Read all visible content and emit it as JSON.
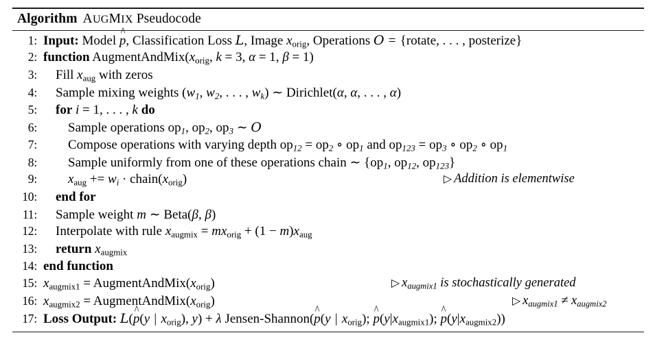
{
  "algorithm": {
    "header_keyword": "Algorithm",
    "title": "AUGMIX Pseudocode",
    "title_smallcaps_part": "AugMix",
    "title_rest": "Pseudocode",
    "lines": [
      {
        "number": "1:",
        "indent": 0,
        "keyword": "Input:",
        "text": "Model p̂, Classification Loss L, Image x_orig, Operations O = {rotate, . . . , posterize}",
        "comment": ""
      },
      {
        "number": "2:",
        "indent": 0,
        "keyword": "function",
        "text": "AugmentAndMix(x_orig, k = 3, α = 1, β = 1)",
        "comment": ""
      },
      {
        "number": "3:",
        "indent": 1,
        "keyword": "",
        "text": "Fill x_aug with zeros",
        "comment": ""
      },
      {
        "number": "4:",
        "indent": 1,
        "keyword": "",
        "text": "Sample mixing weights (w_1, w_2, . . . , w_k) ~ Dirichlet(α, α, . . . , α)",
        "comment": ""
      },
      {
        "number": "5:",
        "indent": 1,
        "keyword": "for ... do",
        "text": "for i = 1, . . . , k do",
        "comment": ""
      },
      {
        "number": "6:",
        "indent": 2,
        "keyword": "",
        "text": "Sample operations op_1, op_2, op_3 ~ O",
        "comment": ""
      },
      {
        "number": "7:",
        "indent": 2,
        "keyword": "",
        "text": "Compose operations with varying depth op_12 = op_2 ∘ op_1 and op_123 = op_3 ∘ op_2 ∘ op_1",
        "comment": ""
      },
      {
        "number": "8:",
        "indent": 2,
        "keyword": "",
        "text": "Sample uniformly from one of these operations chain ~ {op_1, op_12, op_123}",
        "comment": ""
      },
      {
        "number": "9:",
        "indent": 2,
        "keyword": "",
        "text": "x_aug += w_i · chain(x_orig)",
        "comment": "▷ Addition is elementwise"
      },
      {
        "number": "10:",
        "indent": 1,
        "keyword": "end for",
        "text": "end for",
        "comment": ""
      },
      {
        "number": "11:",
        "indent": 1,
        "keyword": "",
        "text": "Sample weight m ~ Beta(β, β)",
        "comment": ""
      },
      {
        "number": "12:",
        "indent": 1,
        "keyword": "",
        "text": "Interpolate with rule x_augmix = m x_orig + (1 − m) x_aug",
        "comment": ""
      },
      {
        "number": "13:",
        "indent": 1,
        "keyword": "return",
        "text": "return x_augmix",
        "comment": ""
      },
      {
        "number": "14:",
        "indent": 0,
        "keyword": "end function",
        "text": "end function",
        "comment": ""
      },
      {
        "number": "15:",
        "indent": 0,
        "keyword": "",
        "text": "x_augmix1 = AugmentAndMix(x_orig)",
        "comment": "▷ x_augmix1 is stochastically generated"
      },
      {
        "number": "16:",
        "indent": 0,
        "keyword": "",
        "text": "x_augmix2 = AugmentAndMix(x_orig)",
        "comment": "▷ x_augmix1 ≠ x_augmix2"
      },
      {
        "number": "17:",
        "indent": 0,
        "keyword": "Loss Output:",
        "text": "L(p̂(y | x_orig), y) + λ Jensen-Shannon(p̂(y | x_orig); p̂(y|x_augmix1); p̂(y|x_augmix2))",
        "comment": ""
      }
    ],
    "numbers": [
      "1:",
      "2:",
      "3:",
      "4:",
      "5:",
      "6:",
      "7:",
      "8:",
      "9:",
      "10:",
      "11:",
      "12:",
      "13:",
      "14:",
      "15:",
      "16:",
      "17:"
    ],
    "keywords": {
      "input": "Input:",
      "function": "function",
      "for": "for",
      "do": "do",
      "end_for": "end for",
      "return": "return",
      "end_function": "end function",
      "loss_output": "Loss Output:"
    },
    "symbols": {
      "distributed_as": "∼",
      "compose": "∘",
      "triangle": "▷",
      "neq": "≠",
      "lambda": "λ",
      "alpha": "α",
      "beta": "β",
      "mid": "|"
    }
  },
  "colors": {
    "background": "#ffffff",
    "text": "#000000",
    "rule": "#1a1a1a"
  }
}
